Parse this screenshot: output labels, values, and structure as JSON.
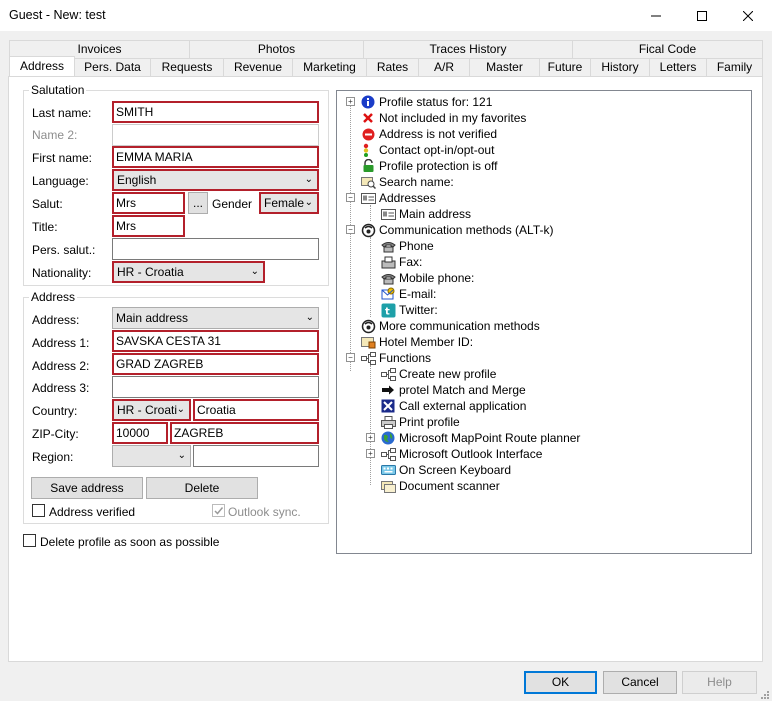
{
  "window": {
    "title": "Guest - New: test"
  },
  "tabs_top": [
    "Invoices",
    "Photos",
    "Traces History",
    "Fical Code"
  ],
  "tabs_bottom": [
    "Address",
    "Pers. Data",
    "Requests",
    "Revenue",
    "Marketing",
    "Rates",
    "A/R",
    "Master",
    "Future",
    "History",
    "Letters",
    "Family"
  ],
  "salutation": {
    "group_label": "Salutation",
    "last_name_label": "Last name:",
    "last_name": "SMITH",
    "name2_label": "Name 2:",
    "name2": "",
    "first_name_label": "First name:",
    "first_name": "EMMA MARIA",
    "language_label": "Language:",
    "language": "English",
    "salut_label": "Salut:",
    "salut": "Mrs",
    "salut_btn": "...",
    "gender_label": "Gender",
    "gender": "Female",
    "title_label": "Title:",
    "title": "Mrs",
    "pers_salut_label": "Pers. salut.:",
    "pers_salut": "",
    "nationality_label": "Nationality:",
    "nationality": "HR - Croatia"
  },
  "address": {
    "group_label": "Address",
    "address_label": "Address:",
    "address_type": "Main address",
    "address1_label": "Address 1:",
    "address1": "SAVSKA CESTA 31",
    "address2_label": "Address 2:",
    "address2": "GRAD ZAGREB",
    "address3_label": "Address 3:",
    "address3": "",
    "country_label": "Country:",
    "country_code": "HR - Croati",
    "country_name": "Croatia",
    "zip_label": "ZIP-City:",
    "zip": "10000",
    "city": "ZAGREB",
    "region_label": "Region:",
    "region": "",
    "region_text": "",
    "save_btn": "Save address",
    "delete_btn": "Delete",
    "verified_label": "Address verified",
    "outlook_label": "Outlook sync."
  },
  "delete_profile_label": "Delete profile as soon as possible",
  "tree": [
    "Profile status for: 121",
    "Not included in my favorites",
    "Address is not verified",
    "Contact opt-in/opt-out",
    "Profile protection is off",
    "Search name:",
    "Addresses",
    "Main address",
    "Communication methods (ALT-k)",
    "Phone",
    "Fax:",
    "Mobile phone:",
    "E-mail:",
    "Twitter:",
    "More communication methods",
    "Hotel Member ID:",
    "Functions",
    "Create new profile",
    "protel Match and Merge",
    "Call external application",
    "Print profile",
    "Microsoft MapPoint Route planner",
    "Microsoft Outlook Interface",
    "On Screen Keyboard",
    "Document scanner"
  ],
  "buttons": {
    "ok": "OK",
    "cancel": "Cancel",
    "help": "Help"
  },
  "colors": {
    "required_border": "#b3202b",
    "ok_border": "#0078d7"
  }
}
